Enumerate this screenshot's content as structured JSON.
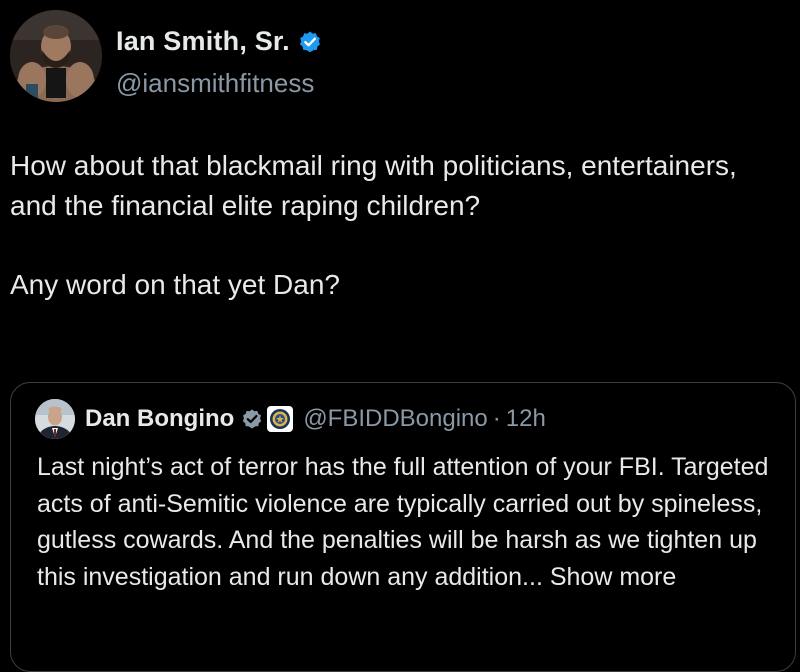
{
  "author": {
    "display_name": "Ian Smith, Sr.",
    "handle": "@iansmithfitness",
    "verified_icon": "verified-badge-icon",
    "badge_color": "#1d9bf0"
  },
  "tweet": {
    "paragraphs": [
      "How about that blackmail ring with politicians, entertainers, and the financial elite raping children?",
      "Any word on that yet Dan?"
    ]
  },
  "quoted_tweet": {
    "display_name": "Dan Bongino",
    "verified_icon": "verified-badge-icon",
    "affiliation_icon": "fbi-seal-icon",
    "handle": "@FBIDDBongino",
    "separator": "·",
    "time": "12h",
    "text": "Last night’s act of terror has the full attention of your FBI. Targeted acts of anti-Semitic violence are typically carried out by spineless, gutless cowards. And the penalties will be harsh as we tighten up this investigation and run down any addition...",
    "show_more_label": "Show more"
  },
  "colors": {
    "background": "#000000",
    "text_primary": "#e7e9ea",
    "text_secondary": "#8b98a5",
    "card_border": "#3a3f44"
  }
}
